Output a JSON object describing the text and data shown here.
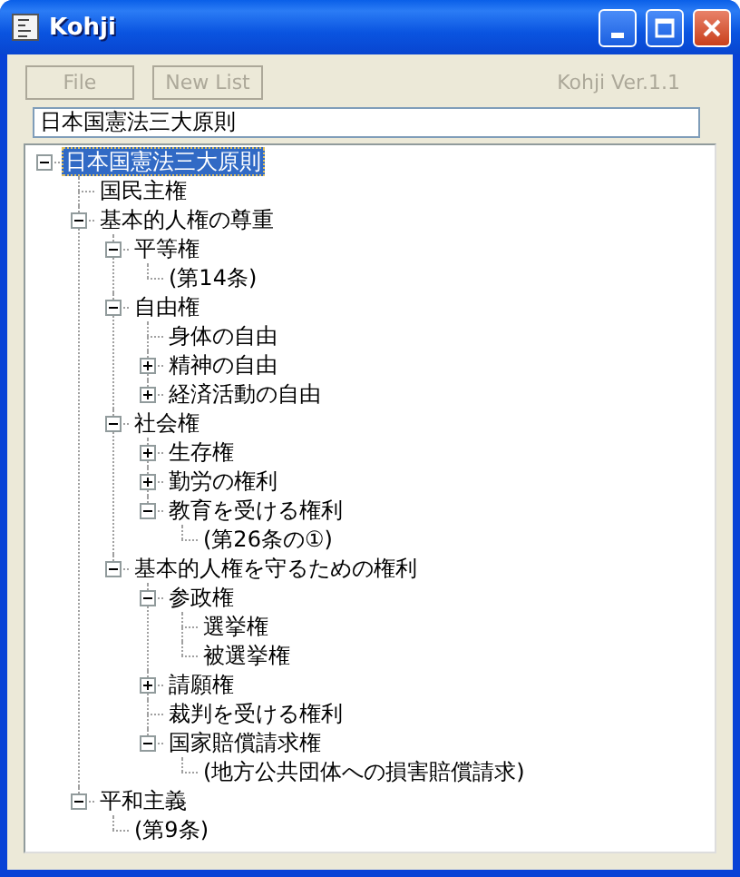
{
  "window": {
    "title": "Kohji"
  },
  "toolbar": {
    "buttons": [
      {
        "label": "File",
        "disabled": true
      },
      {
        "label": "New List",
        "disabled": true
      }
    ],
    "version": "Kohji Ver.1.1"
  },
  "title_field": {
    "value": "日本国憲法三大原則"
  },
  "tree": [
    {
      "label": "日本国憲法三大原則",
      "selected": true,
      "expanded": true,
      "children": [
        {
          "label": "国民主権",
          "selected": false
        },
        {
          "label": "基本的人権の尊重",
          "selected": false,
          "expanded": true,
          "children": [
            {
              "label": "平等権",
              "selected": false,
              "expanded": true,
              "children": [
                {
                  "label": "(第14条)",
                  "selected": false
                }
              ]
            },
            {
              "label": "自由権",
              "selected": false,
              "expanded": true,
              "children": [
                {
                  "label": "身体の自由",
                  "selected": false
                },
                {
                  "label": "精神の自由",
                  "selected": false,
                  "expanded": false
                },
                {
                  "label": "経済活動の自由",
                  "selected": false,
                  "expanded": false
                }
              ]
            },
            {
              "label": "社会権",
              "selected": false,
              "expanded": true,
              "children": [
                {
                  "label": "生存権",
                  "selected": false,
                  "expanded": false
                },
                {
                  "label": "勤労の権利",
                  "selected": false,
                  "expanded": false
                },
                {
                  "label": "教育を受ける権利",
                  "selected": false,
                  "expanded": true,
                  "children": [
                    {
                      "label": "(第26条の①)",
                      "selected": false
                    }
                  ]
                }
              ]
            },
            {
              "label": "基本的人権を守るための権利",
              "selected": false,
              "expanded": true,
              "children": [
                {
                  "label": "参政権",
                  "selected": false,
                  "expanded": true,
                  "children": [
                    {
                      "label": "選挙権",
                      "selected": false
                    },
                    {
                      "label": "被選挙権",
                      "selected": false
                    }
                  ]
                },
                {
                  "label": "請願権",
                  "selected": false,
                  "expanded": false
                },
                {
                  "label": "裁判を受ける権利",
                  "selected": false
                },
                {
                  "label": "国家賠償請求権",
                  "selected": false,
                  "expanded": true,
                  "children": [
                    {
                      "label": "(地方公共団体への損害賠償請求)",
                      "selected": false
                    }
                  ]
                }
              ]
            }
          ]
        },
        {
          "label": "平和主義",
          "selected": false,
          "expanded": true,
          "children": [
            {
              "label": "(第9条)",
              "selected": false
            }
          ]
        }
      ]
    }
  ]
}
